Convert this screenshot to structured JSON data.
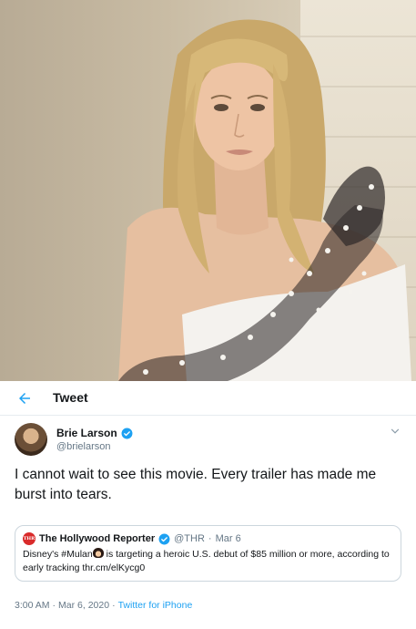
{
  "photo": {
    "subject": "portrait-photo"
  },
  "header": {
    "title": "Tweet",
    "back_icon": "arrow-left-icon"
  },
  "tweet": {
    "author": {
      "name": "Brie Larson",
      "handle": "@brielarson",
      "verified": true
    },
    "text": "I cannot wait to see this movie. Every trailer has made me burst into tears.",
    "quoted": {
      "name": "The Hollywood Reporter",
      "handle": "@THR",
      "separator": "·",
      "date": "Mar 6",
      "logo_text": "THR",
      "text_before_emoji": "Disney's #Mulan",
      "text_after_emoji": " is targeting a heroic U.S. debut of $85 million or more, according to early tracking thr.cm/elKycg0"
    },
    "meta": {
      "time": "3:00 AM",
      "separator1": "·",
      "date": "Mar 6, 2020",
      "separator2": "·",
      "client": "Twitter for iPhone"
    }
  },
  "colors": {
    "accent": "#1da1f2",
    "text": "#14171a",
    "muted": "#657786",
    "border": "#ccd6dd"
  }
}
